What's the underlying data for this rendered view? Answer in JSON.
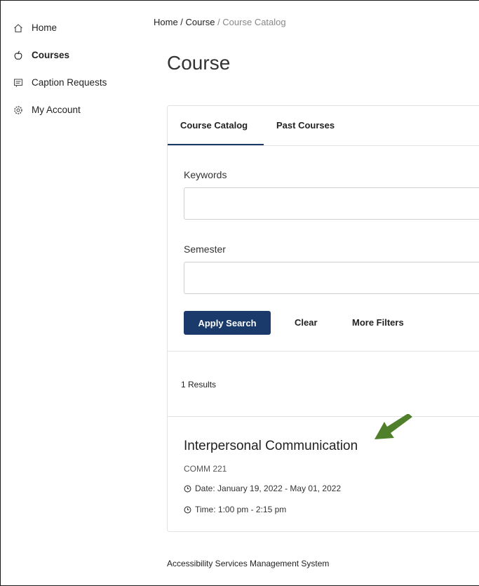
{
  "sidebar": {
    "items": [
      {
        "label": "Home",
        "icon": "home-icon"
      },
      {
        "label": "Courses",
        "icon": "apple-icon"
      },
      {
        "label": "Caption Requests",
        "icon": "caption-icon"
      },
      {
        "label": "My Account",
        "icon": "gear-icon"
      }
    ],
    "active_index": 1
  },
  "breadcrumb": {
    "home": "Home",
    "sep1": " / ",
    "course": "Course",
    "sep2": " / ",
    "current": "Course Catalog"
  },
  "page_title": "Course",
  "tabs": [
    {
      "label": "Course Catalog",
      "active": true
    },
    {
      "label": "Past Courses",
      "active": false
    }
  ],
  "search": {
    "keywords_label": "Keywords",
    "keywords_value": "",
    "semester_label": "Semester",
    "semester_value": "",
    "apply_label": "Apply Search",
    "clear_label": "Clear",
    "more_filters_label": "More Filters"
  },
  "results": {
    "count_text": "1 Results",
    "items": [
      {
        "title": "Interpersonal Communication",
        "code": "COMM 221",
        "date": "Date: January 19, 2022 - May 01, 2022",
        "time": "Time: 1:00 pm - 2:15 pm"
      }
    ]
  },
  "annotation": {
    "arrow_color": "#4f7f2a",
    "arrow_icon": "green-arrow-icon"
  },
  "colors": {
    "primary": "#1a3a6b",
    "border": "#e3e3e3"
  },
  "footer": "Accessibility Services Management System"
}
